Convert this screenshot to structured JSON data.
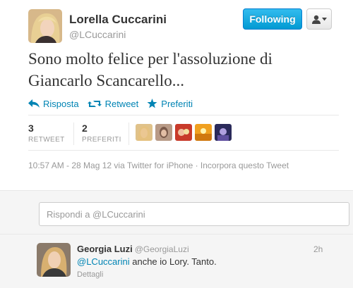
{
  "tweet": {
    "author": {
      "display_name": "Lorella Cuccarini",
      "screen_name": "@LCuccarini"
    },
    "follow_button": "Following",
    "text": "Sono molto felice per l'assoluzione di Giancarlo Scancarello...",
    "actions": {
      "reply": "Risposta",
      "retweet": "Retweet",
      "favorite": "Preferiti"
    },
    "stats": {
      "retweets": "3",
      "retweets_label": "RETWEET",
      "favorites": "2",
      "favorites_label": "PREFERITI"
    },
    "meta": "10:57 AM - 28 Mag 12 via Twitter for iPhone · Incorpora questo Tweet"
  },
  "reply_box": {
    "placeholder": "Rispondi a @LCuccarini"
  },
  "reply": {
    "name": "Georgia Luzi",
    "handle": "@GeorgiaLuzi",
    "time": "2h",
    "mention": "@LCuccarini",
    "text": " anche io Lory. Tanto.",
    "details": "Dettagli"
  },
  "colors": {
    "accent": "#0084b4",
    "follow_button": "#1da1f2"
  },
  "icons": [
    "reply-icon",
    "retweet-icon",
    "star-icon",
    "user-icon",
    "caret-down-icon"
  ]
}
